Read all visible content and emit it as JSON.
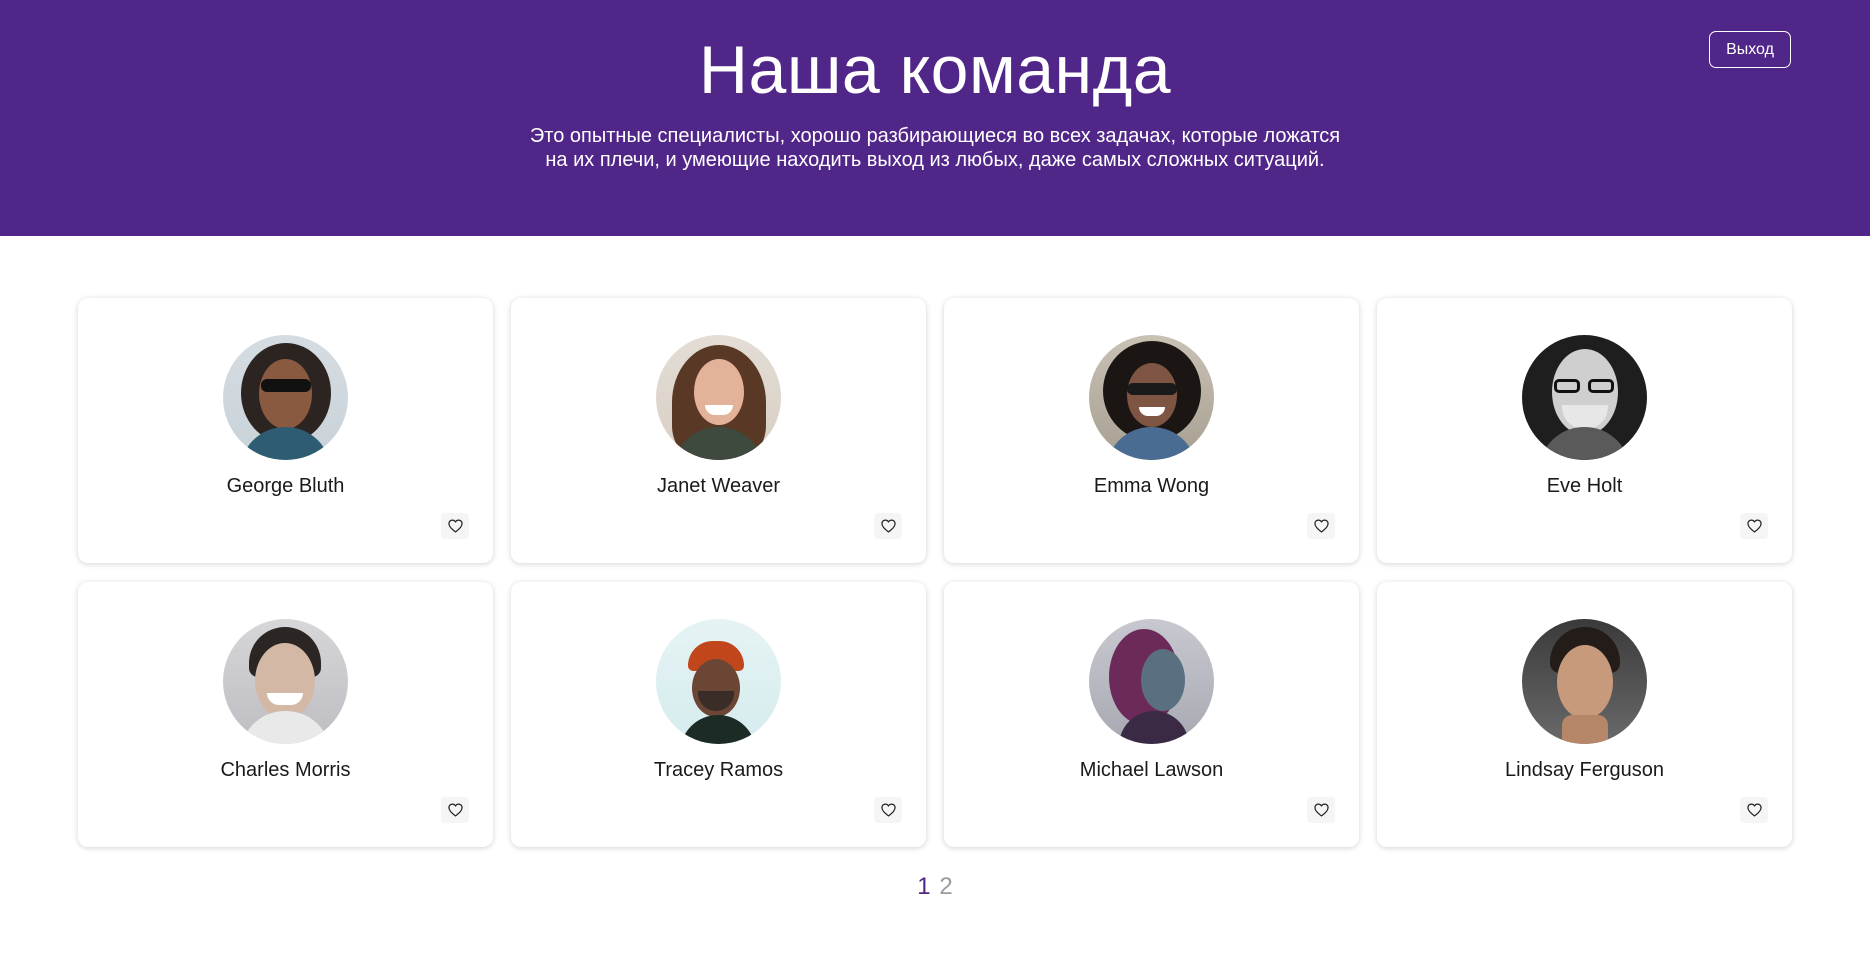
{
  "header": {
    "title": "Наша команда",
    "subtitle_line1": "Это опытные специалисты, хорошо разбирающиеся во всех задачах, которые ложатся",
    "subtitle_line2": "на их плечи, и умеющие находить выход из любых, даже самых сложных ситуаций.",
    "logout_label": "Выход",
    "background_color": "#512689"
  },
  "team": [
    {
      "name": "George Bluth",
      "like_icon": "heart-outline-icon"
    },
    {
      "name": "Janet Weaver",
      "like_icon": "heart-outline-icon"
    },
    {
      "name": "Emma Wong",
      "like_icon": "heart-outline-icon"
    },
    {
      "name": "Eve Holt",
      "like_icon": "heart-outline-icon"
    },
    {
      "name": "Charles Morris",
      "like_icon": "heart-outline-icon"
    },
    {
      "name": "Tracey Ramos",
      "like_icon": "heart-outline-icon"
    },
    {
      "name": "Michael Lawson",
      "like_icon": "heart-outline-icon"
    },
    {
      "name": "Lindsay Ferguson",
      "like_icon": "heart-outline-icon"
    }
  ],
  "pagination": {
    "pages": [
      "1",
      "2"
    ],
    "current": "1",
    "active_color": "#512689",
    "inactive_color": "#9b9b9b"
  }
}
